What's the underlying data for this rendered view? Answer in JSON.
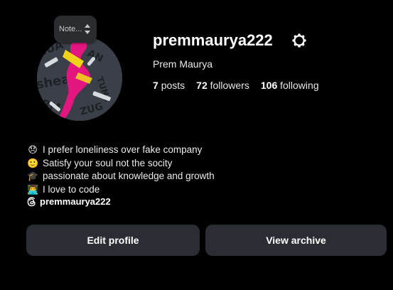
{
  "note": {
    "label": "Note..."
  },
  "profile": {
    "username": "premmaurya222",
    "full_name": "Prem Maurya",
    "stats": [
      {
        "count": "7",
        "label": "posts"
      },
      {
        "count": "72",
        "label": "followers"
      },
      {
        "count": "106",
        "label": "following"
      }
    ]
  },
  "bio": [
    {
      "icon": "😞",
      "text": "I prefer loneliness over fake company"
    },
    {
      "icon": "🙂",
      "text": "Satisfy your soul not the socity"
    },
    {
      "icon": "🎓",
      "text": "passionate about knowledge and growth"
    },
    {
      "icon": "👨‍💻",
      "text": "I love to code"
    }
  ],
  "threads": {
    "handle": "premmaurya222"
  },
  "buttons": {
    "edit_profile": "Edit profile",
    "view_archive": "View archive"
  }
}
